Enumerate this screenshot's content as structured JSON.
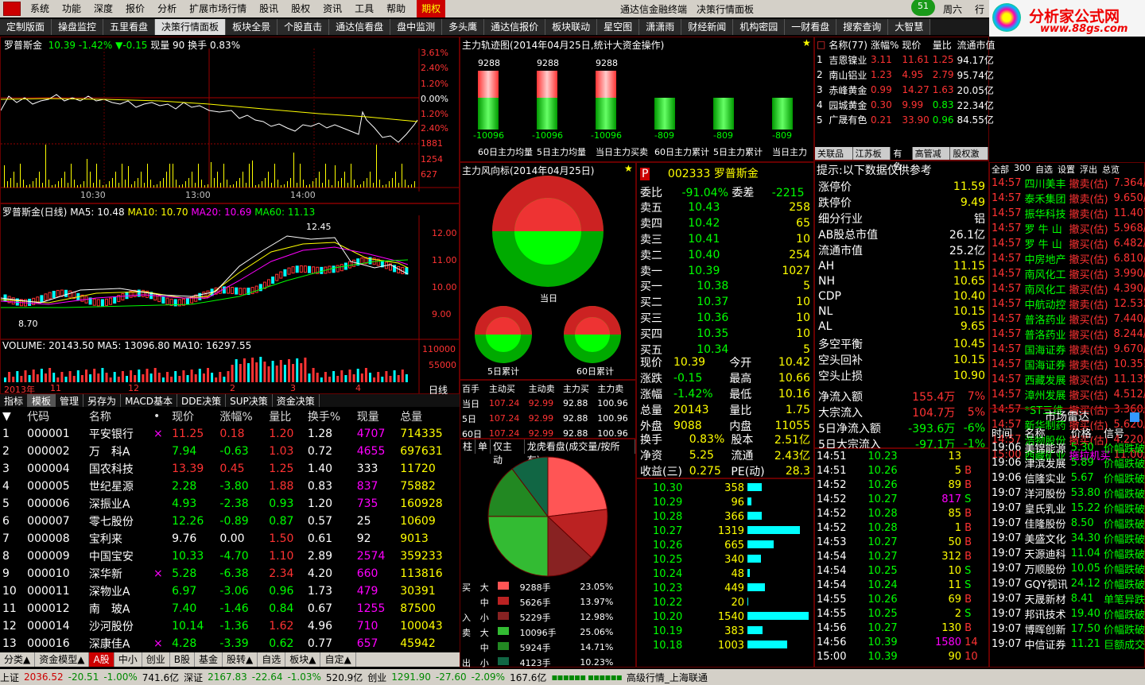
{
  "menu": {
    "items": [
      "系统",
      "功能",
      "深度",
      "报价",
      "分析",
      "扩展市场行情",
      "股讯",
      "股权",
      "资讯",
      "工具",
      "帮助"
    ],
    "qq": "期权",
    "title": "通达信金融终端",
    "title2": "决策行情面板",
    "badge": "51",
    "day": "周六",
    "btn": "行"
  },
  "brand": {
    "name": "分析家公式网",
    "url": "www.88gs.com"
  },
  "tabs": [
    "定制版面",
    "操盘监控",
    "五里看盘",
    "决策行情面板",
    "板块全景",
    "个股直击",
    "通达信看盘",
    "盘中监测",
    "多头鹰",
    "通达信报价",
    "板块联动",
    "星空图",
    "潇潇雨",
    "财经新闻",
    "机构密园",
    "一财看盘",
    "搜索查询",
    "大智慧"
  ],
  "intraday": {
    "header": "罗普斯金",
    "price": "10.39",
    "pct": "-1.42%",
    "chg": "▼-0.15",
    "vol": "现量 90",
    "turn": "换手 0.83%",
    "yaxis": [
      "3.61%",
      "2.40%",
      "1.20%",
      "0.00%",
      "1.20%",
      "2.40%",
      "1881",
      "1254",
      "627"
    ],
    "xaxis": [
      "10:30",
      "13:00",
      "14:00"
    ]
  },
  "daily": {
    "header": "罗普斯金(日线)",
    "ma5": "MA5: 10.48",
    "ma10": "MA10: 10.70",
    "ma20": "MA20: 10.69",
    "ma60": "MA60: 11.13",
    "hi": "12.45",
    "lo": "8.70",
    "yaxis": [
      "12.00",
      "11.00",
      "10.00",
      "9.00"
    ]
  },
  "volume": {
    "header": "VOLUME: 20143.50",
    "ma5": "MA5: 13096.80",
    "ma10": "MA10: 16297.55",
    "yaxis": [
      "110000",
      "55000"
    ],
    "xaxis": [
      "2013年",
      "11",
      "12",
      "2",
      "3",
      "4"
    ],
    "right": "日线"
  },
  "subtabs": [
    "指标",
    "模板",
    "管理",
    "另存为",
    "MACD基本",
    "DDE决策",
    "SUP决策",
    "资金决策"
  ],
  "list": {
    "headers": [
      "代码",
      "名称",
      "•",
      "现价",
      "涨幅%",
      "量比",
      "换手%",
      "现量",
      "总量"
    ],
    "rows": [
      [
        "1",
        "000001",
        "平安银行",
        "×",
        "11.25",
        "0.18",
        "1.20",
        "1.28",
        "4707",
        "714335"
      ],
      [
        "2",
        "000002",
        "万　科A",
        "",
        "7.94",
        "-0.63",
        "1.03",
        "0.72",
        "4655",
        "697631"
      ],
      [
        "3",
        "000004",
        "国农科技",
        "",
        "13.39",
        "0.45",
        "1.25",
        "1.40",
        "333",
        "11720"
      ],
      [
        "4",
        "000005",
        "世纪星源",
        "",
        "2.28",
        "-3.80",
        "1.88",
        "0.83",
        "837",
        "75882"
      ],
      [
        "5",
        "000006",
        "深振业A",
        "",
        "4.93",
        "-2.38",
        "0.93",
        "1.20",
        "735",
        "160928"
      ],
      [
        "6",
        "000007",
        "零七股份",
        "",
        "12.26",
        "-0.89",
        "0.87",
        "0.57",
        "25",
        "10609"
      ],
      [
        "7",
        "000008",
        "宝利来",
        "",
        "9.76",
        "0.00",
        "1.50",
        "0.61",
        "92",
        "9013"
      ],
      [
        "8",
        "000009",
        "中国宝安",
        "",
        "10.33",
        "-4.70",
        "1.10",
        "2.89",
        "2574",
        "359233"
      ],
      [
        "9",
        "000010",
        "深华新",
        "×",
        "5.28",
        "-6.38",
        "2.34",
        "4.20",
        "660",
        "113816"
      ],
      [
        "10",
        "000011",
        "深物业A",
        "",
        "6.97",
        "-3.06",
        "0.96",
        "1.73",
        "479",
        "30391"
      ],
      [
        "11",
        "000012",
        "南　玻A",
        "",
        "7.40",
        "-1.46",
        "0.84",
        "0.67",
        "1255",
        "87500"
      ],
      [
        "12",
        "000014",
        "沙河股份",
        "",
        "10.14",
        "-1.36",
        "1.62",
        "4.96",
        "710",
        "100043"
      ],
      [
        "13",
        "000016",
        "深康佳A",
        "×",
        "4.28",
        "-3.39",
        "0.62",
        "0.77",
        "657",
        "45942"
      ]
    ]
  },
  "bottomtabs": [
    "分类▲",
    "资金模型▲",
    "A股",
    "中小",
    "创业",
    "B股",
    "基金",
    "股转▲",
    "自选",
    "板块▲",
    "自定▲"
  ],
  "track": {
    "title": "主力轨迹图(2014年04月25日,统计大资金操作)",
    "top": [
      "9288",
      "9288",
      "9288"
    ],
    "bot": [
      "-10096",
      "-10096",
      "-10096",
      "-809",
      "-809",
      "-809"
    ],
    "labels": [
      "60日主力均量",
      "5日主力均量",
      "当日主力买卖",
      "60日主力累计",
      "5日主力累计",
      "当日主力"
    ]
  },
  "wind": {
    "title": "主力风向标(2014年04月25日)",
    "c1": "当日",
    "c2": "5日累计",
    "c3": "60日累计"
  },
  "flowtable": {
    "headers": [
      "百手",
      "主动买",
      "主动卖",
      "主力买",
      "主力卖"
    ],
    "rows": [
      [
        "当日",
        "107.24",
        "92.99",
        "92.88",
        "100.96"
      ],
      [
        "5日",
        "107.24",
        "92.99",
        "92.88",
        "100.96"
      ],
      [
        "60日",
        "107.24",
        "92.99",
        "92.88",
        "100.96"
      ]
    ]
  },
  "pie": {
    "tabs": [
      "柱",
      "单",
      "仅主动",
      "龙虎看盘(成交量/按所有)"
    ],
    "buy": [
      [
        "大",
        "9288手",
        "23.05%"
      ],
      [
        "中",
        "5626手",
        "13.97%"
      ],
      [
        "小",
        "5229手",
        "12.98%"
      ]
    ],
    "sell": [
      [
        "大",
        "10096手",
        "25.06%"
      ],
      [
        "中",
        "5924手",
        "14.71%"
      ],
      [
        "小",
        "4123手",
        "10.23%"
      ]
    ],
    "buylabel": "买入",
    "selllabel": "卖出"
  },
  "rank": {
    "headers": [
      "名称(77)",
      "涨幅%",
      "现价",
      "量比",
      "流通市值"
    ],
    "rows": [
      [
        "1",
        "吉恩镍业",
        "3.11",
        "11.61",
        "1.25",
        "94.17亿"
      ],
      [
        "2",
        "南山铝业",
        "1.23",
        "4.95",
        "2.79",
        "95.74亿"
      ],
      [
        "3",
        "赤峰黄金",
        "0.99",
        "14.27",
        "1.63",
        "20.05亿"
      ],
      [
        "4",
        "园城黄金",
        "0.30",
        "9.99",
        "0.83",
        "22.34亿"
      ],
      [
        "5",
        "广晟有色",
        "0.21",
        "33.90",
        "0.96",
        "84.55亿"
      ]
    ],
    "tabs": [
      "关联品种",
      "江苏板块",
      "有色",
      "高管减持",
      "股权激励"
    ]
  },
  "quote": {
    "code": "002333",
    "name": "罗普斯金",
    "wb": "委比",
    "wbv": "-91.04%",
    "wc": "委差",
    "wcv": "-2215",
    "sells": [
      [
        "卖五",
        "10.43",
        "258"
      ],
      [
        "卖四",
        "10.42",
        "65"
      ],
      [
        "卖三",
        "10.41",
        "10"
      ],
      [
        "卖二",
        "10.40",
        "254"
      ],
      [
        "卖一",
        "10.39",
        "1027"
      ]
    ],
    "buys": [
      [
        "买一",
        "10.38",
        "5"
      ],
      [
        "买二",
        "10.37",
        "10"
      ],
      [
        "买三",
        "10.36",
        "10"
      ],
      [
        "买四",
        "10.35",
        "10"
      ],
      [
        "买五",
        "10.34",
        "5"
      ]
    ],
    "stats": [
      [
        "现价",
        "10.39",
        "今开",
        "10.42"
      ],
      [
        "涨跌",
        "-0.15",
        "最高",
        "10.66"
      ],
      [
        "涨幅",
        "-1.42%",
        "最低",
        "10.16"
      ],
      [
        "总量",
        "20143",
        "量比",
        "1.75"
      ],
      [
        "外盘",
        "9088",
        "内盘",
        "11055"
      ]
    ],
    "stats2": [
      [
        "换手",
        "0.83%",
        "股本",
        "2.51亿"
      ],
      [
        "净资",
        "5.25",
        "流通",
        "2.43亿"
      ],
      [
        "收益(三)",
        "0.275",
        "PE(动)",
        "28.3"
      ]
    ]
  },
  "depth": [
    [
      "10.30",
      "358",
      18
    ],
    [
      "10.29",
      "96",
      5
    ],
    [
      "10.28",
      "366",
      18
    ],
    [
      "10.27",
      "1319",
      66
    ],
    [
      "10.26",
      "665",
      33
    ],
    [
      "10.25",
      "340",
      17
    ],
    [
      "10.24",
      "48",
      3
    ],
    [
      "10.23",
      "449",
      22
    ],
    [
      "10.22",
      "20",
      1
    ],
    [
      "10.20",
      "1540",
      77
    ],
    [
      "10.19",
      "383",
      19
    ],
    [
      "10.18",
      "1003",
      50
    ]
  ],
  "info": {
    "title": "提示:以下数据仅供参考",
    "rows": [
      [
        "涨停价",
        "11.59"
      ],
      [
        "跌停价",
        "9.49"
      ],
      [
        "细分行业",
        "铝"
      ],
      [
        "AB股总市值",
        "26.1亿"
      ],
      [
        "流通市值",
        "25.2亿"
      ]
    ],
    "ref": [
      [
        "AH",
        "11.15"
      ],
      [
        "NH",
        "10.65"
      ],
      [
        "CDP",
        "10.40"
      ],
      [
        "NL",
        "10.15"
      ],
      [
        "AL",
        "9.65"
      ]
    ],
    "ls": [
      [
        "多空平衡",
        "10.45"
      ],
      [
        "空头回补",
        "10.15"
      ],
      [
        "空头止损",
        "10.90"
      ]
    ],
    "flows": [
      [
        "净流入额",
        "155.4万",
        "7%"
      ],
      [
        "大宗流入",
        "104.7万",
        "5%"
      ],
      [
        "5日净流入额",
        "-393.6万",
        "-6%"
      ],
      [
        "5日大宗流入",
        "-97.1万",
        "-1%"
      ]
    ]
  },
  "ticks": [
    [
      "14:51",
      "10.23",
      "13",
      ""
    ],
    [
      "14:51",
      "10.26",
      "5",
      "B"
    ],
    [
      "14:52",
      "10.26",
      "89",
      "B"
    ],
    [
      "14:52",
      "10.27",
      "817",
      "S"
    ],
    [
      "14:52",
      "10.28",
      "85",
      "B"
    ],
    [
      "14:52",
      "10.28",
      "1",
      "B"
    ],
    [
      "14:53",
      "10.27",
      "50",
      "B"
    ],
    [
      "14:54",
      "10.27",
      "312",
      "B"
    ],
    [
      "14:54",
      "10.25",
      "10",
      "S"
    ],
    [
      "14:54",
      "10.24",
      "11",
      "S"
    ],
    [
      "14:55",
      "10.26",
      "69",
      "B"
    ],
    [
      "14:55",
      "10.25",
      "2",
      "S"
    ],
    [
      "14:56",
      "10.27",
      "130",
      "B"
    ],
    [
      "14:56",
      "10.39",
      "1580",
      "14"
    ],
    [
      "15:00",
      "10.39",
      "90",
      "10"
    ]
  ],
  "rightpanel": {
    "tabs": [
      "全部",
      "300",
      "自选",
      "设置",
      "浮出",
      "总览"
    ],
    "rows": [
      [
        "14:57",
        "四川美丰",
        "撤卖(估)",
        "7.364/274"
      ],
      [
        "14:57",
        "泰禾集团",
        "撤卖(估)",
        "9.650/876"
      ],
      [
        "14:57",
        "振华科技",
        "撤卖(估)",
        "11.407/60"
      ],
      [
        "14:57",
        "罗 牛 山",
        "撤买(估)",
        "5.968/675"
      ],
      [
        "14:57",
        "罗 牛 山",
        "撤买(估)",
        "6.482/408"
      ],
      [
        "14:57",
        "中房地产",
        "撤买(估)",
        "6.810/179"
      ],
      [
        "14:57",
        "南风化工",
        "撤买(估)",
        "3.990/576"
      ],
      [
        "14:57",
        "南风化工",
        "撤买(估)",
        "4.390/303"
      ],
      [
        "14:57",
        "中航动控",
        "撤卖(估)",
        "12.532/80"
      ],
      [
        "14:57",
        "普洛药业",
        "撤买(估)",
        "7.440/140"
      ],
      [
        "14:57",
        "普洛药业",
        "撤买(估)",
        "8.244/491"
      ],
      [
        "14:57",
        "国海证券",
        "撤卖(估)",
        "9.670/102"
      ],
      [
        "14:57",
        "国海证券",
        "撤卖(估)",
        "10.351/40"
      ],
      [
        "14:57",
        "西藏发展",
        "撤买(估)",
        "11.135/16"
      ],
      [
        "14:57",
        "漳州发展",
        "撤买(估)",
        "4.512/256"
      ],
      [
        "14:57",
        "*ST三维",
        "撤买(估)",
        "3.360/117"
      ],
      [
        "14:57",
        "新华制药",
        "撤买(估)",
        "5.620/116"
      ],
      [
        "14:57",
        "浩物股份",
        "撤买(估)",
        "4.220/134"
      ],
      [
        "15:00",
        "西藏矿业",
        "拖拉机买",
        "11.00/122"
      ]
    ],
    "radar": "市场雷达",
    "radarhdr": [
      "时间",
      "名称",
      "价格",
      "信号"
    ],
    "radarrows": [
      [
        "19:06",
        "美锦能源",
        "5.30",
        "价幅跌破"
      ],
      [
        "19:06",
        "津滨发展",
        "5.89",
        "价幅跌破"
      ],
      [
        "19:06",
        "信隆实业",
        "5.67",
        "价幅跌破"
      ],
      [
        "19:07",
        "洋河股份",
        "53.80",
        "价幅跌破"
      ],
      [
        "19:07",
        "皇氏乳业",
        "15.22",
        "价幅跌破"
      ],
      [
        "19:07",
        "佳隆股份",
        "8.50",
        "价幅跌破"
      ],
      [
        "19:07",
        "美盛文化",
        "34.30",
        "价幅跌破"
      ],
      [
        "19:07",
        "天源迪科",
        "11.04",
        "价幅跌破"
      ],
      [
        "19:07",
        "万顺股份",
        "10.05",
        "价幅跌破"
      ],
      [
        "19:07",
        "GQY视讯",
        "24.12",
        "价幅跌破"
      ],
      [
        "19:07",
        "天晟新材",
        "8.41",
        "单笔异跌"
      ],
      [
        "19:07",
        "邦讯技术",
        "19.40",
        "价幅跌破"
      ],
      [
        "19:07",
        "博晖创新",
        "17.50",
        "价幅跌破"
      ],
      [
        "19:07",
        "中信证券",
        "11.21",
        "巨额成交"
      ]
    ]
  },
  "status": {
    "sh": "上证",
    "shv": "2036.52",
    "shc": "-20.51",
    "shp": "-1.00%",
    "sha": "741.6亿",
    "sz": "深证",
    "szv": "2167.83",
    "szc": "-22.64",
    "szp": "-1.03%",
    "sza": "520.9亿",
    "cy": "创业",
    "cyv": "1291.90",
    "cyc": "-27.60",
    "cyp": "-2.09%",
    "cya": "167.6亿",
    "feed": "高级行情_上海联通"
  }
}
